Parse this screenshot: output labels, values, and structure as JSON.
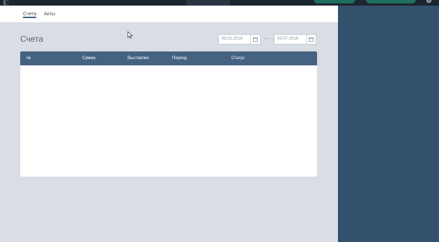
{
  "subtabs": [
    {
      "label": "Счета",
      "active": true
    },
    {
      "label": "Акты",
      "active": false
    }
  ],
  "page": {
    "title": "Счета"
  },
  "date_range": {
    "from": "03.01.2016",
    "separator": "—",
    "to": "03.07.2016"
  },
  "table": {
    "columns": [
      "№",
      "Сумма",
      "Выставлен",
      "Период",
      "Статус"
    ],
    "rows": []
  },
  "colors": {
    "topbar": "#1d2530",
    "side_panel": "#33506d",
    "table_header": "#466282",
    "page_bg": "#d9dde4",
    "accent": "#2ec4a6"
  },
  "icons": [
    "calendar-icon",
    "cursor-arrow-icon",
    "gear-icon",
    "logo-icon"
  ]
}
